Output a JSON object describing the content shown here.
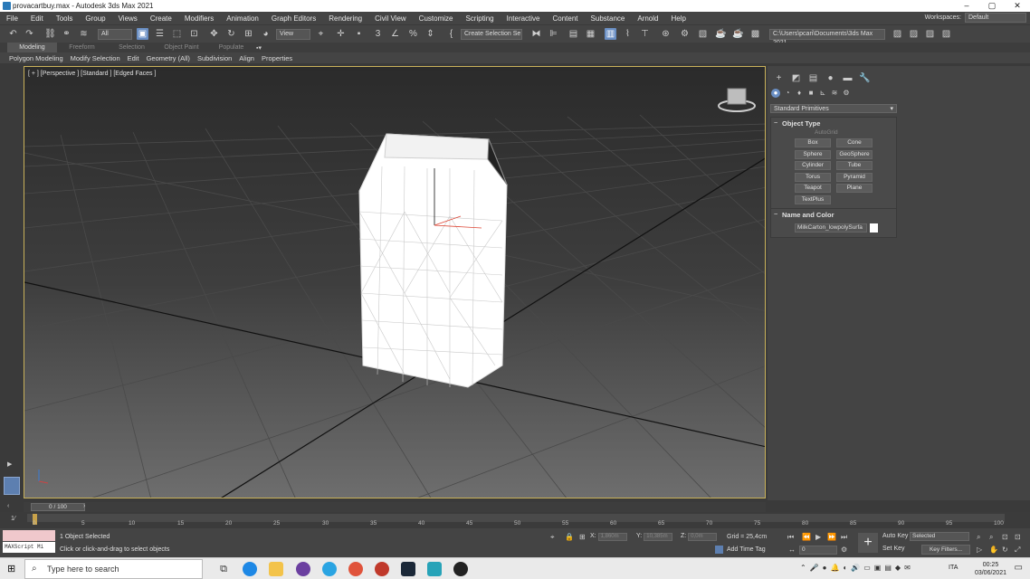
{
  "window": {
    "title": "provacartbuy.max - Autodesk 3ds Max 2021",
    "controls": [
      "–",
      "▢",
      "✕"
    ]
  },
  "menu": {
    "items": [
      "File",
      "Edit",
      "Tools",
      "Group",
      "Views",
      "Create",
      "Modifiers",
      "Animation",
      "Graph Editors",
      "Rendering",
      "Civil View",
      "Customize",
      "Scripting",
      "Interactive",
      "Content",
      "Substance",
      "Arnold",
      "Help"
    ],
    "workspaces_label": "Workspaces:",
    "workspaces_value": "Default"
  },
  "toolbar": {
    "selection_filter": "All",
    "ref_coord": "View",
    "named_selection": "Create Selection Se",
    "project_path": "C:\\Users\\pcari\\Documents\\3ds Max 2021"
  },
  "ribbon": {
    "tabs": [
      "Modeling",
      "Freeform",
      "Selection",
      "Object Paint",
      "Populate"
    ],
    "items": [
      "Polygon Modeling",
      "Modify Selection",
      "Edit",
      "Geometry (All)",
      "Subdivision",
      "Align",
      "Properties"
    ]
  },
  "viewport": {
    "label": "[ + ] [Perspective ] [Standard ] [Edged Faces ]"
  },
  "command_panel": {
    "category": "Standard Primitives",
    "object_type_title": "Object Type",
    "autogrid": "AutoGrid",
    "primitives": [
      "Box",
      "Cone",
      "Sphere",
      "GeoSphere",
      "Cylinder",
      "Tube",
      "Torus",
      "Pyramid",
      "Teapot",
      "Plane",
      "TextPlus"
    ],
    "name_color_title": "Name and Color",
    "object_name": "MilkCarton_lowpolySurfa",
    "object_color": "#ffffff"
  },
  "timeline": {
    "frame_counter": "0 / 100",
    "ticks": [
      "0",
      "5",
      "10",
      "15",
      "20",
      "25",
      "30",
      "35",
      "40",
      "45",
      "50",
      "55",
      "60",
      "65",
      "70",
      "75",
      "80",
      "85",
      "90",
      "95",
      "100"
    ]
  },
  "status": {
    "maxscript": "MAXScript Mi",
    "selected": "1 Object Selected",
    "prompt": "Click or click-and-drag to select objects",
    "x_label": "X:",
    "x_value": "1,860m",
    "y_label": "Y:",
    "y_value": "10,385m",
    "z_label": "Z:",
    "z_value": "0,0m",
    "grid": "Grid = 25,4cm",
    "add_time_tag": "Add Time Tag",
    "auto_key": "Auto Key",
    "set_key": "Set Key",
    "key_mode": "Selected",
    "key_filters": "Key Filters...",
    "frame": "0"
  },
  "taskbar": {
    "search_placeholder": "Type here to search",
    "language": "ITA",
    "time": "00:25",
    "date": "03/06/2021"
  }
}
